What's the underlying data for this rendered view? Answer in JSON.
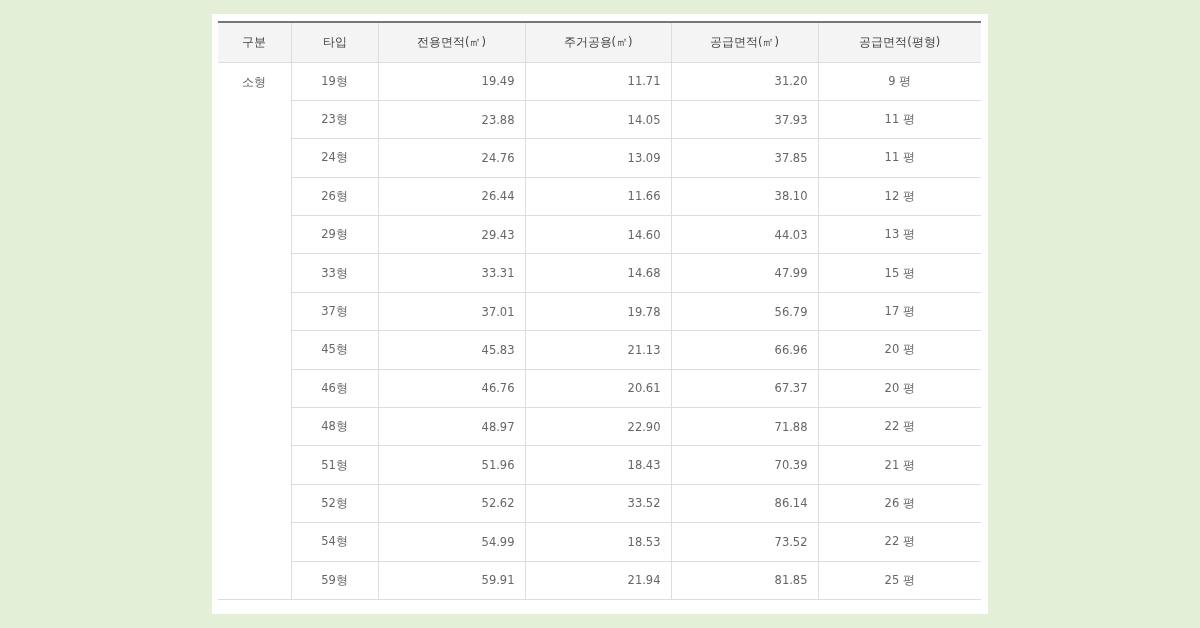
{
  "table": {
    "columns": [
      "구분",
      "타입",
      "전용면적(㎡)",
      "주거공용(㎡)",
      "공급면적(㎡)",
      "공급면적(평형)"
    ],
    "rows": [
      [
        {
          "text": "소형",
          "rowspan": 14
        },
        "19형",
        "19.49",
        "11.71",
        "31.20",
        "9 평"
      ],
      [
        "23형",
        "23.88",
        "14.05",
        "37.93",
        "11 평"
      ],
      [
        "24형",
        "24.76",
        "13.09",
        "37.85",
        "11 평"
      ],
      [
        "26형",
        "26.44",
        "11.66",
        "38.10",
        "12 평"
      ],
      [
        "29형",
        "29.43",
        "14.60",
        "44.03",
        "13 평"
      ],
      [
        "33형",
        "33.31",
        "14.68",
        "47.99",
        "15 평"
      ],
      [
        "37형",
        "37.01",
        "19.78",
        "56.79",
        "17 평"
      ],
      [
        "45형",
        "45.83",
        "21.13",
        "66.96",
        "20 평"
      ],
      [
        "46형",
        "46.76",
        "20.61",
        "67.37",
        "20 평"
      ],
      [
        "48형",
        "48.97",
        "22.90",
        "71.88",
        "22 평"
      ],
      [
        "51형",
        "51.96",
        "18.43",
        "70.39",
        "21 평"
      ],
      [
        "52형",
        "52.62",
        "33.52",
        "86.14",
        "26 평"
      ],
      [
        "54형",
        "54.99",
        "18.53",
        "73.52",
        "22 평"
      ],
      [
        "59형",
        "59.91",
        "21.94",
        "81.85",
        "25 평"
      ]
    ]
  }
}
